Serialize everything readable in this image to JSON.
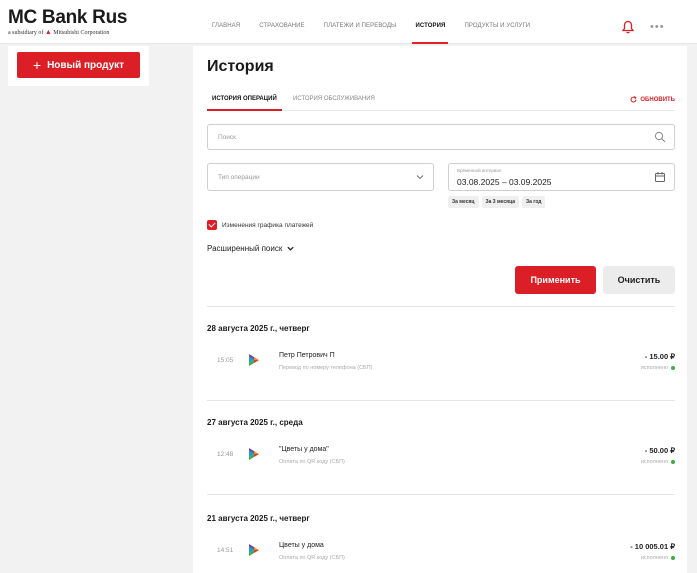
{
  "brand": {
    "name": "MC Bank Rus",
    "subtitle_prefix": "a subsidiary of",
    "subtitle_company": "Mitsubishi Corporation",
    "accent_color": "#dc1f26"
  },
  "nav": {
    "items": [
      "ГЛАВНАЯ",
      "СТРАХОВАНИЕ",
      "ПЛАТЕЖИ И ПЕРЕВОДЫ",
      "ИСТОРИЯ",
      "ПРОДУКТЫ И УСЛУГИ"
    ],
    "active": "ИСТОРИЯ",
    "more": "•••"
  },
  "sidebar": {
    "new_product_label": "Новый продукт",
    "new_product_icon": "+"
  },
  "page": {
    "title": "История"
  },
  "tabs": {
    "operations": "ИСТОРИЯ ОПЕРАЦИЙ",
    "service": "ИСТОРИЯ ОБСЛУЖИВАНИЯ",
    "refresh": "ОБНОВИТЬ"
  },
  "filters": {
    "search_placeholder": "Поиск",
    "operation_type_placeholder": "Тип операции",
    "date_range_label": "Временной интервал",
    "date_range_value": "03.08.2025 – 03.09.2025",
    "quick_ranges": [
      "За месяц",
      "За 3 месяца",
      "За год"
    ],
    "checkbox_label": "Изменения графика платежей",
    "checkbox_checked": true,
    "advanced_search": "Расширенный поиск",
    "apply": "Применить",
    "clear": "Очистить"
  },
  "history": [
    {
      "date": "28 августа 2025 г., четверг",
      "time": "15:05",
      "name": "Петр Петрович П",
      "desc": "Перевод по номеру телефона (СБП)",
      "amount": "- 15.00 ₽",
      "status": "исполнено"
    },
    {
      "date": "27 августа 2025 г., среда",
      "time": "12:48",
      "name": "\"Цветы у дома\"",
      "desc": "Оплата по QR коду (СБП)",
      "amount": "- 50.00 ₽",
      "status": "исполнено"
    },
    {
      "date": "21 августа 2025 г., четверг",
      "time": "14:51",
      "name": "Цветы у дома",
      "desc": "Оплата по QR коду (СБП)",
      "amount": "- 10 005.01 ₽",
      "status": "исполнено"
    }
  ]
}
